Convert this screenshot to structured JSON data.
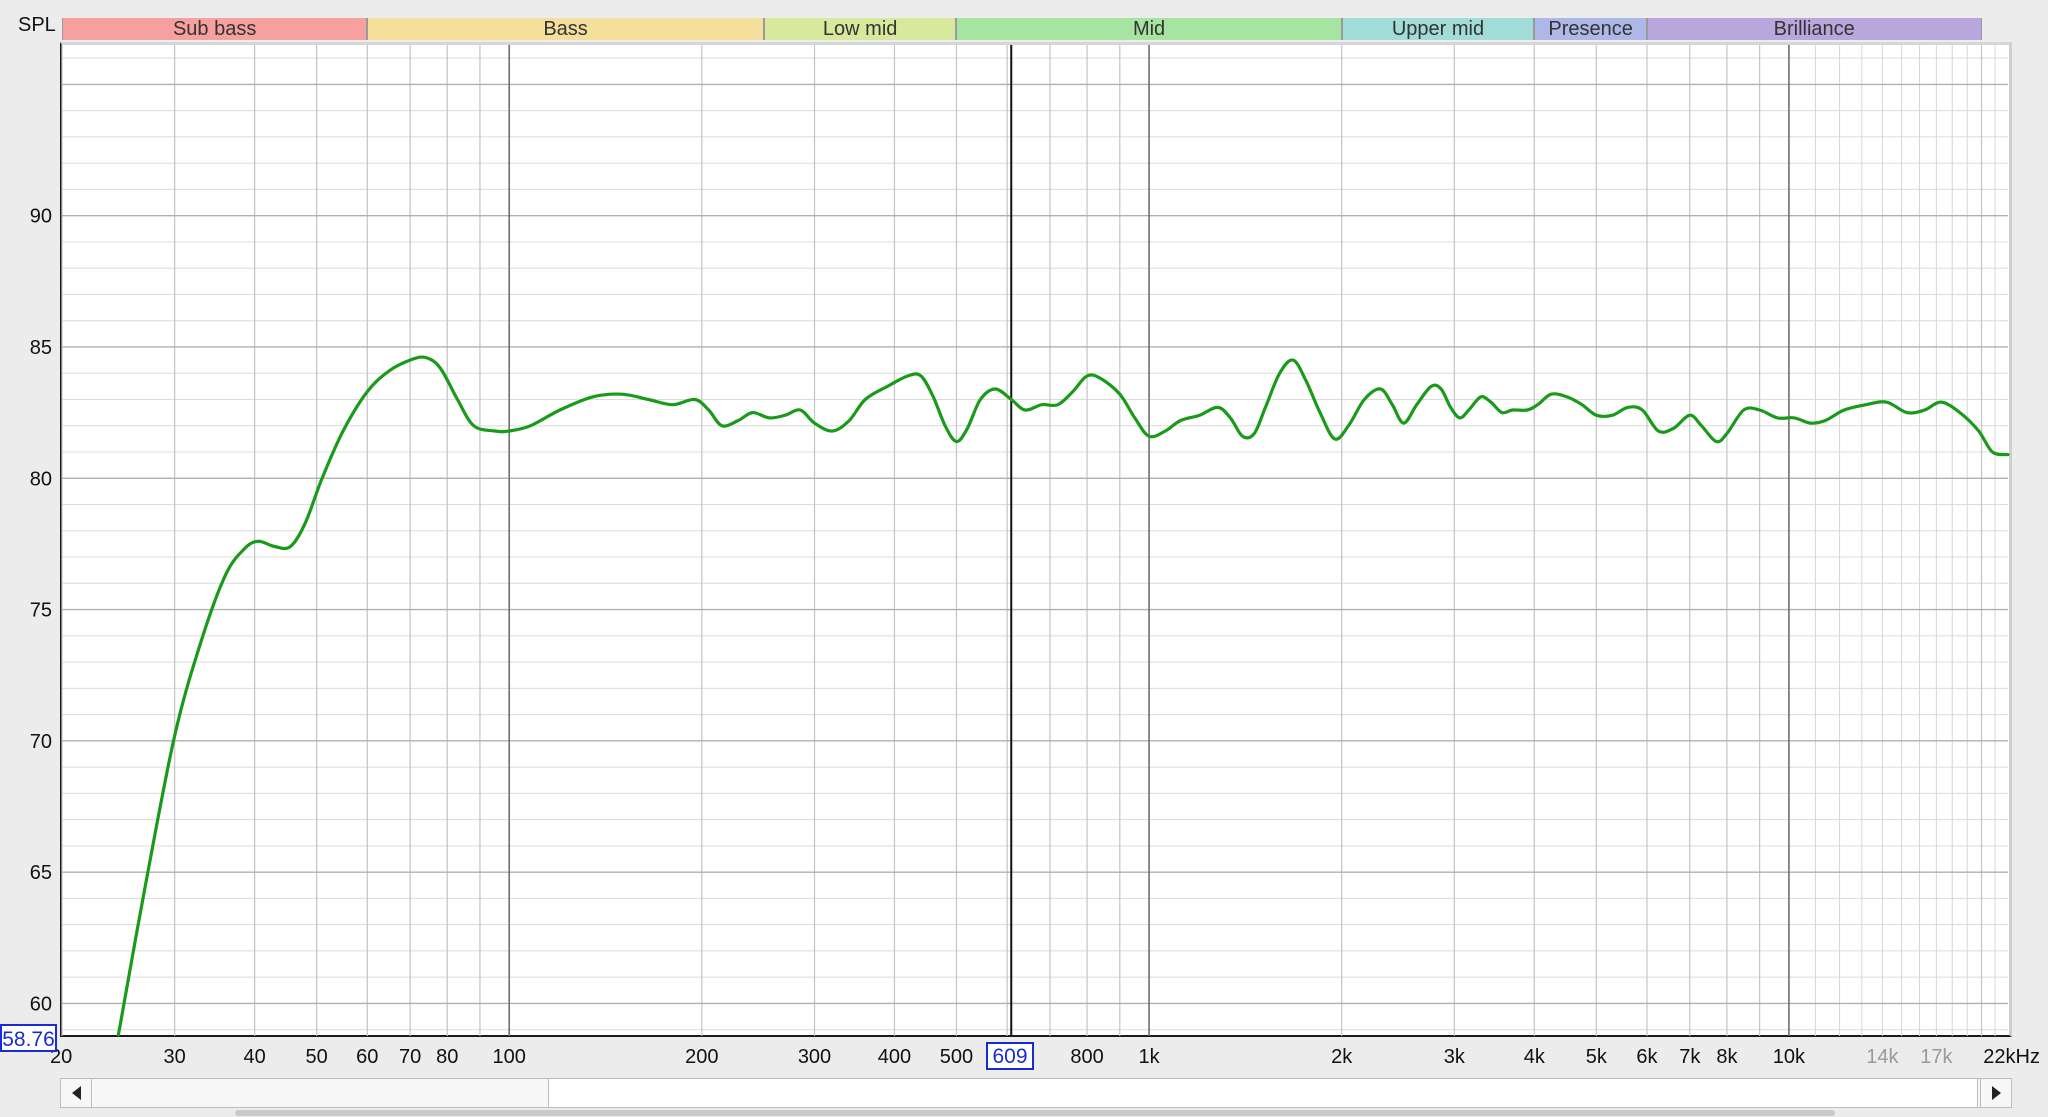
{
  "chart_data": {
    "type": "line",
    "ylabel": "SPL",
    "x_scale": "log",
    "xlim": [
      20,
      22000
    ],
    "ylim": [
      58.76,
      96.5
    ],
    "y_ticks": [
      60,
      65,
      70,
      75,
      80,
      85,
      90
    ],
    "y_tick_labels": [
      "60",
      "65",
      "70",
      "75",
      "80",
      "85",
      "90"
    ],
    "x_tick_labels": [
      {
        "label": "20",
        "f": 20
      },
      {
        "label": "30",
        "f": 30
      },
      {
        "label": "40",
        "f": 40
      },
      {
        "label": "50",
        "f": 50
      },
      {
        "label": "60",
        "f": 60
      },
      {
        "label": "70",
        "f": 70
      },
      {
        "label": "80",
        "f": 80
      },
      {
        "label": "100",
        "f": 100
      },
      {
        "label": "200",
        "f": 200
      },
      {
        "label": "300",
        "f": 300
      },
      {
        "label": "400",
        "f": 400
      },
      {
        "label": "500",
        "f": 500
      },
      {
        "label": "800",
        "f": 800
      },
      {
        "label": "1k",
        "f": 1000
      },
      {
        "label": "2k",
        "f": 2000
      },
      {
        "label": "3k",
        "f": 3000
      },
      {
        "label": "4k",
        "f": 4000
      },
      {
        "label": "5k",
        "f": 5000
      },
      {
        "label": "6k",
        "f": 6000
      },
      {
        "label": "7k",
        "f": 7000
      },
      {
        "label": "8k",
        "f": 8000
      },
      {
        "label": "10k",
        "f": 10000
      },
      {
        "label": "14k",
        "f": 14000,
        "dim": true
      },
      {
        "label": "17k",
        "f": 17000,
        "dim": true
      },
      {
        "label": "22kHz",
        "f": 22000
      }
    ],
    "bands": [
      {
        "name": "Sub bass",
        "from": 20,
        "to": 60,
        "color": "#f6a0a0"
      },
      {
        "name": "Bass",
        "from": 60,
        "to": 250,
        "color": "#f5df9c"
      },
      {
        "name": "Low mid",
        "from": 250,
        "to": 500,
        "color": "#d8e89c"
      },
      {
        "name": "Mid",
        "from": 500,
        "to": 2000,
        "color": "#a6e4a2"
      },
      {
        "name": "Upper mid",
        "from": 2000,
        "to": 4000,
        "color": "#a2dcd8"
      },
      {
        "name": "Presence",
        "from": 4000,
        "to": 6000,
        "color": "#aeb8e8"
      },
      {
        "name": "Brilliance",
        "from": 6000,
        "to": 20000,
        "color": "#b9a6dc"
      }
    ],
    "cursor": {
      "x_label": "609",
      "x_value": 609,
      "y_label": "58.76",
      "y_value": 58.76
    },
    "series": [
      {
        "color": "#1a9a1a",
        "points": [
          [
            24.5,
            58.8
          ],
          [
            27,
            64.5
          ],
          [
            30,
            70.2
          ],
          [
            33,
            73.8
          ],
          [
            36,
            76.3
          ],
          [
            38.5,
            77.3
          ],
          [
            40.5,
            77.6
          ],
          [
            43,
            77.4
          ],
          [
            45.5,
            77.4
          ],
          [
            48,
            78.3
          ],
          [
            51,
            80.0
          ],
          [
            55,
            81.8
          ],
          [
            60,
            83.3
          ],
          [
            65,
            84.1
          ],
          [
            70,
            84.5
          ],
          [
            74,
            84.6
          ],
          [
            78,
            84.2
          ],
          [
            83,
            83.0
          ],
          [
            88,
            82.0
          ],
          [
            95,
            81.8
          ],
          [
            100,
            81.8
          ],
          [
            108,
            82.0
          ],
          [
            120,
            82.6
          ],
          [
            135,
            83.1
          ],
          [
            150,
            83.2
          ],
          [
            165,
            83.0
          ],
          [
            180,
            82.8
          ],
          [
            195,
            83.0
          ],
          [
            205,
            82.6
          ],
          [
            215,
            82.0
          ],
          [
            228,
            82.2
          ],
          [
            240,
            82.5
          ],
          [
            255,
            82.3
          ],
          [
            270,
            82.4
          ],
          [
            285,
            82.6
          ],
          [
            300,
            82.1
          ],
          [
            320,
            81.8
          ],
          [
            340,
            82.2
          ],
          [
            360,
            83.0
          ],
          [
            390,
            83.5
          ],
          [
            420,
            83.9
          ],
          [
            440,
            83.9
          ],
          [
            460,
            83.1
          ],
          [
            480,
            82.0
          ],
          [
            500,
            81.4
          ],
          [
            520,
            81.9
          ],
          [
            545,
            83.0
          ],
          [
            575,
            83.4
          ],
          [
            609,
            83.0
          ],
          [
            640,
            82.6
          ],
          [
            680,
            82.8
          ],
          [
            720,
            82.8
          ],
          [
            760,
            83.3
          ],
          [
            800,
            83.9
          ],
          [
            840,
            83.8
          ],
          [
            900,
            83.2
          ],
          [
            950,
            82.3
          ],
          [
            1000,
            81.6
          ],
          [
            1060,
            81.8
          ],
          [
            1120,
            82.2
          ],
          [
            1200,
            82.4
          ],
          [
            1280,
            82.7
          ],
          [
            1340,
            82.3
          ],
          [
            1400,
            81.6
          ],
          [
            1460,
            81.7
          ],
          [
            1520,
            82.7
          ],
          [
            1600,
            84.0
          ],
          [
            1680,
            84.5
          ],
          [
            1760,
            83.7
          ],
          [
            1850,
            82.5
          ],
          [
            1950,
            81.5
          ],
          [
            2050,
            82.0
          ],
          [
            2170,
            83.0
          ],
          [
            2300,
            83.4
          ],
          [
            2400,
            82.8
          ],
          [
            2500,
            82.1
          ],
          [
            2620,
            82.8
          ],
          [
            2760,
            83.5
          ],
          [
            2860,
            83.4
          ],
          [
            2960,
            82.7
          ],
          [
            3060,
            82.3
          ],
          [
            3160,
            82.6
          ],
          [
            3300,
            83.1
          ],
          [
            3420,
            82.9
          ],
          [
            3560,
            82.5
          ],
          [
            3700,
            82.6
          ],
          [
            3900,
            82.6
          ],
          [
            4050,
            82.8
          ],
          [
            4250,
            83.2
          ],
          [
            4500,
            83.1
          ],
          [
            4750,
            82.8
          ],
          [
            5000,
            82.4
          ],
          [
            5300,
            82.4
          ],
          [
            5600,
            82.7
          ],
          [
            5900,
            82.6
          ],
          [
            6250,
            81.8
          ],
          [
            6600,
            81.9
          ],
          [
            7000,
            82.4
          ],
          [
            7300,
            82.0
          ],
          [
            7700,
            81.4
          ],
          [
            8000,
            81.7
          ],
          [
            8500,
            82.6
          ],
          [
            9000,
            82.6
          ],
          [
            9600,
            82.3
          ],
          [
            10200,
            82.3
          ],
          [
            10800,
            82.1
          ],
          [
            11400,
            82.2
          ],
          [
            12200,
            82.6
          ],
          [
            13200,
            82.8
          ],
          [
            14200,
            82.9
          ],
          [
            15300,
            82.5
          ],
          [
            16300,
            82.6
          ],
          [
            17300,
            82.9
          ],
          [
            18500,
            82.5
          ],
          [
            19800,
            81.8
          ],
          [
            20800,
            81.0
          ],
          [
            22000,
            80.9
          ]
        ]
      }
    ]
  }
}
